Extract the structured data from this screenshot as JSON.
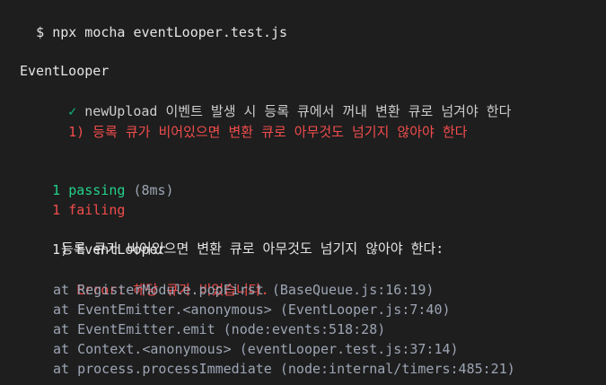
{
  "command": {
    "prompt": "$",
    "text": "npx mocha eventLooper.test.js"
  },
  "suite": {
    "name": "EventLooper",
    "tests": [
      {
        "status": "pass",
        "mark": "✓",
        "title": "newUpload 이벤트 발생 시 등록 큐에서 꺼내 변환 큐로 넘겨야 한다"
      },
      {
        "status": "fail",
        "mark": "1)",
        "title": "등록 큐가 비어있으면 변환 큐로 아무것도 넘기지 않아야 한다"
      }
    ]
  },
  "summary": {
    "passing_count": "1",
    "passing_label": "passing",
    "passing_time": "(8ms)",
    "failing_count": "1",
    "failing_label": "failing"
  },
  "failure": {
    "index": "1)",
    "suite": "EventLooper",
    "title": "등록 큐가 비어있으면 변환 큐로 아무것도 넘기지 않아야 한다:",
    "error_label": "Error:",
    "error_message": "해당 큐가 비었습니다.",
    "stack": [
      "at RegisterModule.popFirst (BaseQueue.js:16:19)",
      "at EventEmitter.<anonymous> (EventLooper.js:7:40)",
      "at EventEmitter.emit (node:events:518:28)",
      "at Context.<anonymous> (eventLooper.test.js:37:14)",
      "at process.processImmediate (node:internal/timers:485:21)"
    ]
  },
  "colors": {
    "background": "#1e1e1e",
    "pass": "#23d18b",
    "fail": "#f14c4c",
    "text": "#cccccc"
  }
}
